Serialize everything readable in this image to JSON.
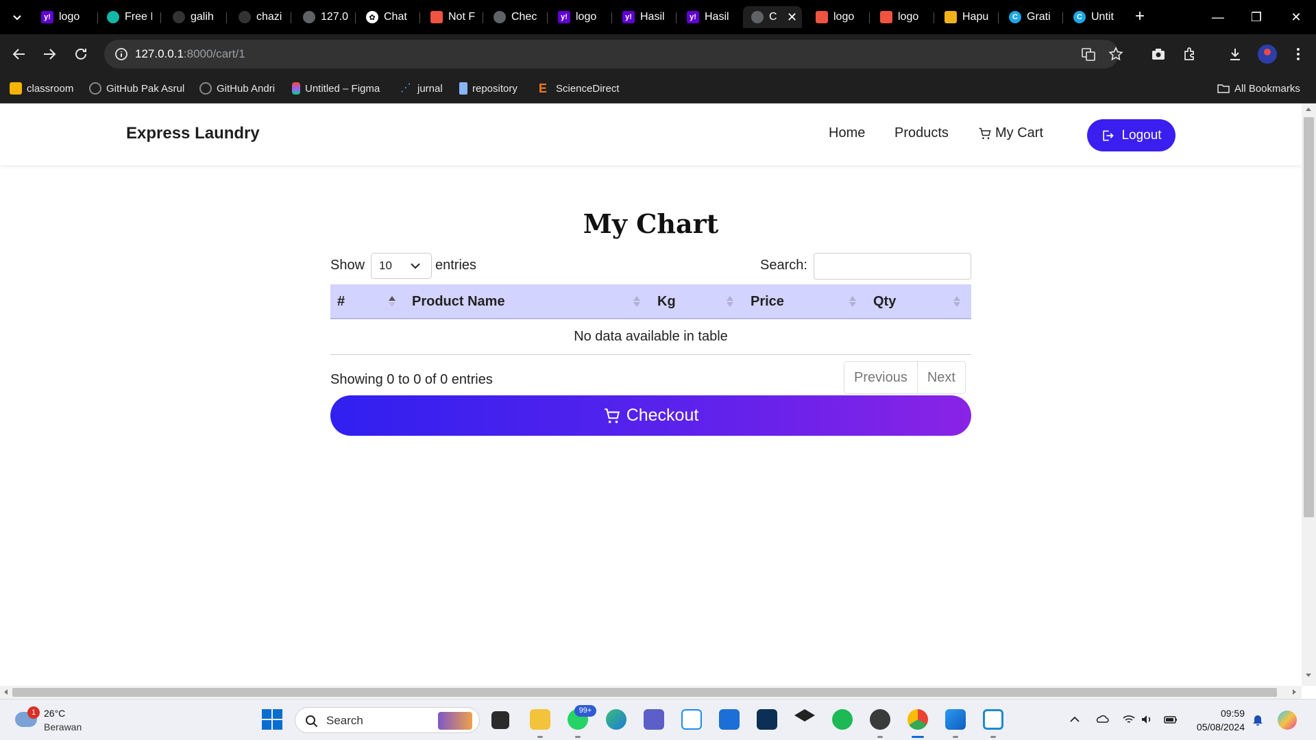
{
  "browser": {
    "tabs": [
      {
        "title": "logo",
        "icon": "yahoo-icon",
        "color": "#6001d2"
      },
      {
        "title": "Free I",
        "icon": "circle-app-icon",
        "color": "#11b8a8"
      },
      {
        "title": "galih",
        "icon": "github-icon",
        "color": "#333333"
      },
      {
        "title": "chazi",
        "icon": "github-icon",
        "color": "#333333"
      },
      {
        "title": "127.0",
        "icon": "globe-icon",
        "color": "#5f6368"
      },
      {
        "title": "Chat",
        "icon": "chatgpt-icon",
        "color": "#ffffff"
      },
      {
        "title": "Not F",
        "icon": "laravel-icon",
        "color": "#f05340"
      },
      {
        "title": "Chec",
        "icon": "globe-icon",
        "color": "#5f6368"
      },
      {
        "title": "logo",
        "icon": "yahoo-icon",
        "color": "#6001d2"
      },
      {
        "title": "Hasil",
        "icon": "yahoo-icon",
        "color": "#6001d2"
      },
      {
        "title": "Hasil",
        "icon": "yahoo-icon",
        "color": "#6001d2"
      },
      {
        "title": "C",
        "icon": "globe-icon",
        "color": "#5f6368"
      },
      {
        "title": "logo",
        "icon": "laravel-icon",
        "color": "#f05340"
      },
      {
        "title": "logo",
        "icon": "laravel-icon",
        "color": "#f05340"
      },
      {
        "title": "Hapu",
        "icon": "book-icon",
        "color": "#f2b21c"
      },
      {
        "title": "Grati",
        "icon": "canva-icon",
        "color": "#1ea7e6"
      },
      {
        "title": "Untit",
        "icon": "canva-icon",
        "color": "#1ea7e6"
      }
    ],
    "url_host": "127.0.0.1",
    "url_path": ":8000/cart/1",
    "bookmarks": [
      {
        "label": "classroom",
        "icon": "classroom-icon"
      },
      {
        "label": "GitHub Pak Asrul",
        "icon": "github-icon"
      },
      {
        "label": "GitHub Andri",
        "icon": "github-icon"
      },
      {
        "label": "Untitled – Figma",
        "icon": "figma-icon"
      },
      {
        "label": "jurnal",
        "icon": "network-icon"
      },
      {
        "label": "repository",
        "icon": "file-icon"
      },
      {
        "label": "ScienceDirect",
        "icon": "elsevier-icon"
      }
    ],
    "all_bookmarks": "All Bookmarks"
  },
  "navbar": {
    "brand": "Express Laundry",
    "home": "Home",
    "products": "Products",
    "my_cart": "My Cart",
    "logout": "Logout",
    "accent": "#3a1ff0"
  },
  "main": {
    "heading": "My Chart",
    "show_label": "Show",
    "entries_label": "entries",
    "page_length": "10",
    "search_label": "Search:",
    "search_value": "",
    "table": {
      "columns": [
        "#",
        "Product Name",
        "Kg",
        "Price",
        "Qty"
      ],
      "empty_message": "No data available in table",
      "header_color": "#d3d3ff"
    },
    "info": "Showing 0 to 0 of 0 entries",
    "previous": "Previous",
    "next": "Next",
    "checkout": "Checkout"
  },
  "taskbar": {
    "weather_badge": "1",
    "temperature": "26°C",
    "condition": "Berawan",
    "search": "Search",
    "whatsapp_badge": "99+",
    "time": "09:59",
    "date": "05/08/2024"
  }
}
